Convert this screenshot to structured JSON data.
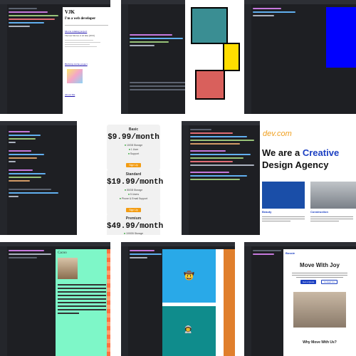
{
  "tile1": {
    "heading": "VJK",
    "subheading": "I'm a web developer",
    "project1_link": "Movie ranking project",
    "project1_subtitle": "The best Movies of all time (2019)",
    "project2_link": "Birthday invite project",
    "footer_link": "About Me"
  },
  "tile6": {
    "plans": [
      {
        "name": "Basic",
        "price": "$9.99/month",
        "features": [
          "10GB Storage",
          "1 User",
          "Support"
        ],
        "button": "Sign Up"
      },
      {
        "name": "Standard",
        "price": "$19.99/month",
        "features": [
          "50GB Storage",
          "5 Users",
          "Phone & Email Support"
        ],
        "button": "Sign Up"
      },
      {
        "name": "Premium",
        "price": "$49.99/month",
        "features": [
          "100GB Storage"
        ]
      }
    ]
  },
  "tile8": {
    "logo": "dev.com",
    "hero_prefix": "We are a ",
    "hero_accent": "Creative",
    "hero_suffix": "Design Agency",
    "card1_title": "Beauty",
    "card2_title": "Construction"
  },
  "tile9": {
    "title": "Cacoo"
  },
  "tile10": {
    "emoji_top": "🤠",
    "emoji_bottom": "👨‍🚀"
  },
  "tile12": {
    "logo": "Bossie",
    "hero_title": "Move With Joy",
    "primary_button": "Get a Quote",
    "secondary_button": "Contact Us",
    "section_title": "Why Move With Us?"
  },
  "colors": {
    "editor_bg": "#1e1f23",
    "accent_blue": "#1b3fc2",
    "accent_orange": "#f0a020",
    "teal": "#0f8c8c",
    "sky": "#29a9e8",
    "mint": "#7ef7c8",
    "coral": "#d9605c",
    "yellow": "#ffdd00",
    "pure_blue": "#0000ff"
  }
}
